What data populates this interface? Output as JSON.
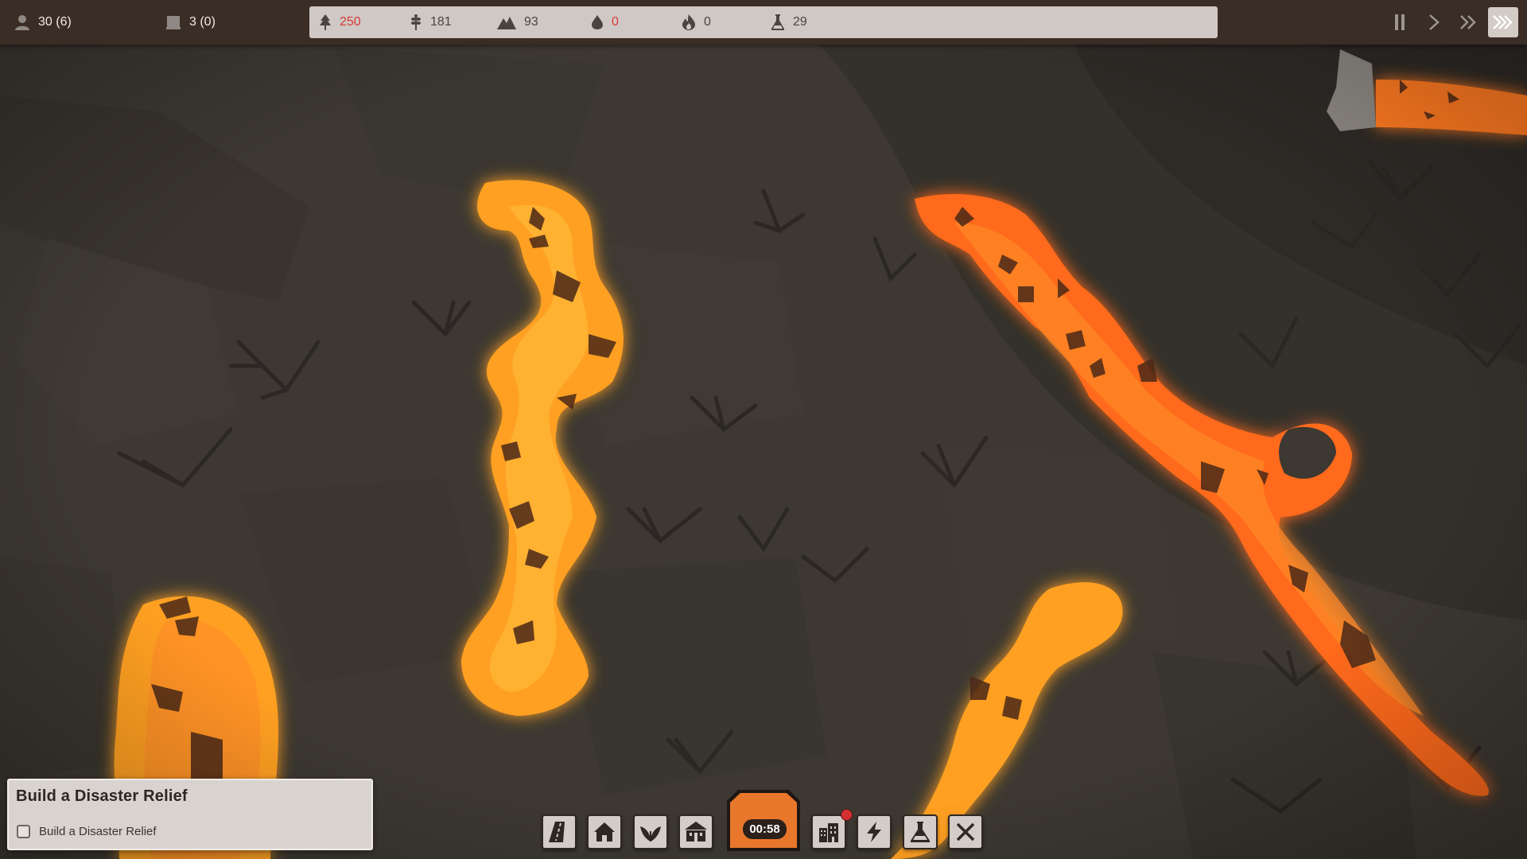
{
  "hud": {
    "population": "30 (6)",
    "housing": "3 (0)",
    "resources": [
      {
        "name": "wood",
        "icon": "tree-icon",
        "value": "250",
        "alert": true
      },
      {
        "name": "food",
        "icon": "wheat-icon",
        "value": "181",
        "alert": false
      },
      {
        "name": "stone",
        "icon": "mountain-icon",
        "value": "93",
        "alert": false
      },
      {
        "name": "water",
        "icon": "droplet-icon",
        "value": "0",
        "alert": true
      },
      {
        "name": "fire",
        "icon": "flame-icon",
        "value": "0",
        "alert": false
      },
      {
        "name": "research",
        "icon": "flask-icon",
        "value": "29",
        "alert": false
      }
    ],
    "speed_controls": [
      {
        "name": "pause",
        "icon": "pause-icon",
        "active": false
      },
      {
        "name": "play",
        "icon": "play-icon",
        "active": false
      },
      {
        "name": "fast",
        "icon": "fast-forward-icon",
        "active": false
      },
      {
        "name": "fastest",
        "icon": "fastest-forward-icon",
        "active": true
      }
    ]
  },
  "objective": {
    "title": "Build a Disaster Relief",
    "task": "Build a Disaster Relief",
    "completed": false
  },
  "toolbar": {
    "timer": "00:58",
    "tools": [
      "road-icon",
      "house-icon",
      "farm-leaf-icon",
      "town-hall-icon",
      "building-icon",
      "lightning-icon",
      "flask-icon",
      "close-icon"
    ],
    "notification_on": "building-icon"
  },
  "colors": {
    "ground": "#3b3731",
    "lava_bright": "#ffa525",
    "lava_deep": "#ff6b1a",
    "panel": "#cfc8c4",
    "topbar": "#3a2d25",
    "alert": "#d83a3a",
    "timer_orange": "#e8772c"
  }
}
